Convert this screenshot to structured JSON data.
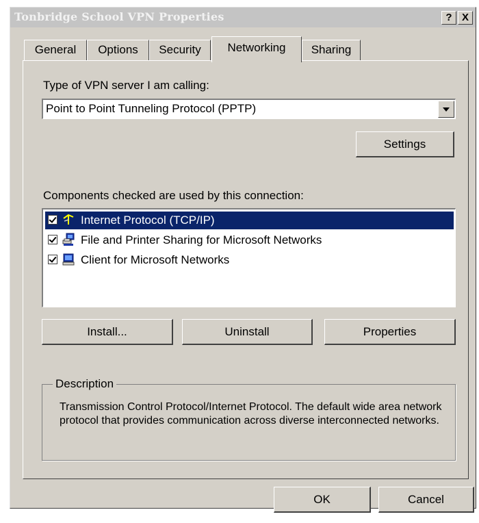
{
  "window": {
    "title": "Tonbridge School VPN Properties",
    "help_button": "?",
    "close_button": "X"
  },
  "tabs": [
    {
      "label": "General",
      "active": false
    },
    {
      "label": "Options",
      "active": false
    },
    {
      "label": "Security",
      "active": false
    },
    {
      "label": "Networking",
      "active": true
    },
    {
      "label": "Sharing",
      "active": false
    }
  ],
  "networking": {
    "server_type_label": "Type of VPN server I am calling:",
    "server_type_value": "Point to Point Tunneling Protocol (PPTP)",
    "settings_button": "Settings",
    "components_label": "Components checked are used by this connection:",
    "components": [
      {
        "label": "Internet Protocol (TCP/IP)",
        "checked": true,
        "selected": true,
        "icon": "network-protocol-icon"
      },
      {
        "label": "File and Printer Sharing for Microsoft Networks",
        "checked": true,
        "selected": false,
        "icon": "file-printer-sharing-icon"
      },
      {
        "label": "Client for Microsoft Networks",
        "checked": true,
        "selected": false,
        "icon": "network-client-icon"
      }
    ],
    "install_button": "Install...",
    "uninstall_button": "Uninstall",
    "properties_button": "Properties",
    "description_label": "Description",
    "description_text": "Transmission Control Protocol/Internet Protocol. The default wide area network protocol that provides communication across diverse interconnected networks."
  },
  "footer": {
    "ok_button": "OK",
    "cancel_button": "Cancel"
  },
  "colors": {
    "dialog_bg": "#d4d0c8",
    "selection_bg": "#0a246a",
    "titlebar_bg": "#c4c4c4"
  }
}
